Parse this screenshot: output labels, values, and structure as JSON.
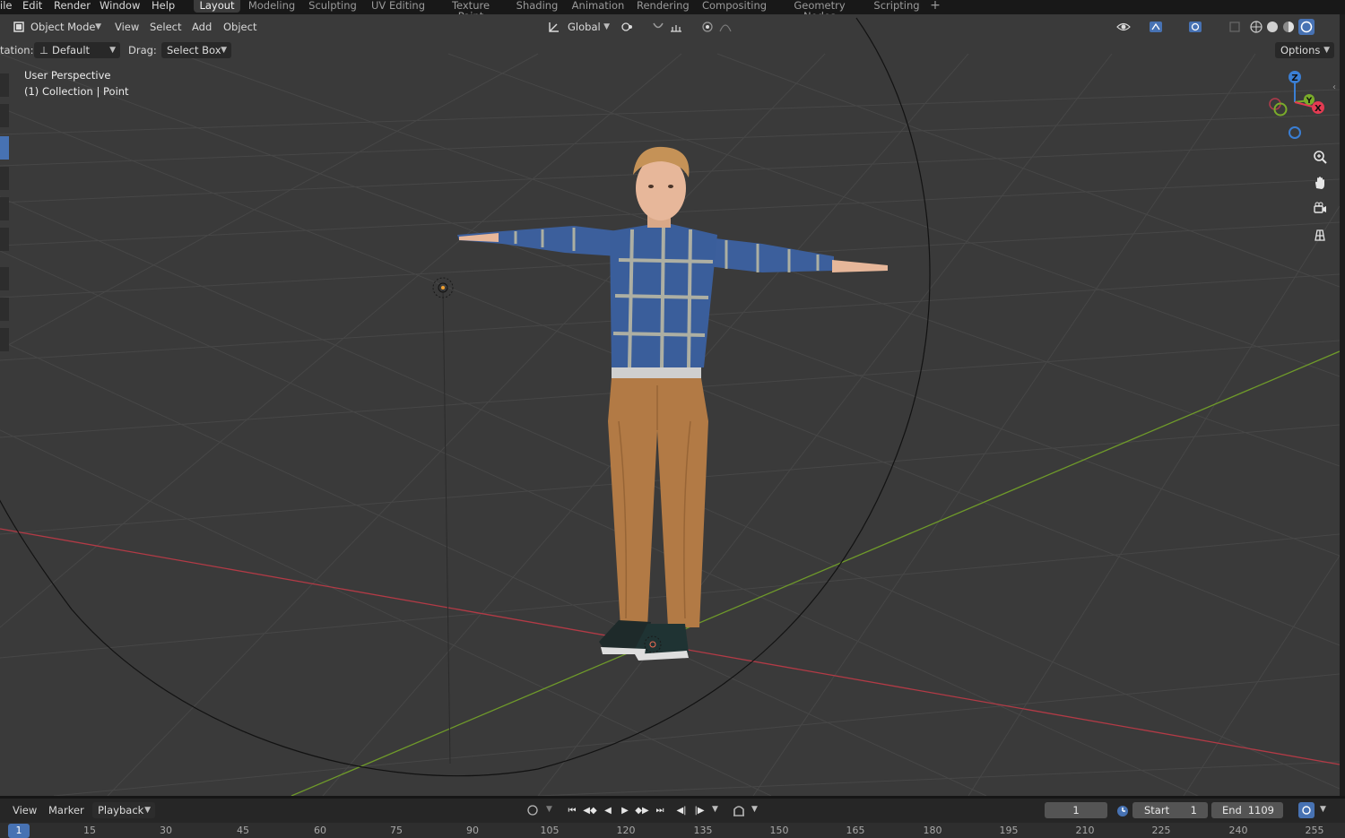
{
  "menu": {
    "items": [
      "ile",
      "Edit",
      "Render",
      "Window",
      "Help"
    ]
  },
  "workspaces": {
    "tabs": [
      "Layout",
      "Modeling",
      "Sculpting",
      "UV Editing",
      "Texture Paint",
      "Shading",
      "Animation",
      "Rendering",
      "Compositing",
      "Geometry Nodes",
      "Scripting"
    ],
    "active": "Layout",
    "add_label": "+"
  },
  "viewport_header": {
    "mode_label": "Object Mode",
    "menus": [
      "View",
      "Select",
      "Add",
      "Object"
    ],
    "transform_orientation": "Global"
  },
  "tool_settings": {
    "orientation_label": "tation:",
    "orientation_value": "Default",
    "drag_label": "Drag:",
    "drag_value": "Select Box",
    "options_label": "Options"
  },
  "viewport_overlay": {
    "view_name": "User Perspective",
    "collection_info": "(1) Collection | Point"
  },
  "gizmo": {
    "axis_labels": [
      "Z",
      "Y",
      "X"
    ],
    "colors": {
      "x": "#e33b52",
      "y": "#7aac2a",
      "z": "#3a7fd5"
    }
  },
  "timeline": {
    "menus": [
      "View",
      "Marker"
    ],
    "playback_label": "Playback",
    "current_frame": "1",
    "start_label": "Start",
    "start_value": "1",
    "end_label": "End",
    "end_value": "1109",
    "ruler_current": "1",
    "ruler_ticks": [
      "15",
      "30",
      "45",
      "60",
      "75",
      "90",
      "105",
      "120",
      "135",
      "150",
      "165",
      "180",
      "195",
      "210",
      "225",
      "240",
      "255"
    ]
  },
  "colors": {
    "accent": "#4772b3",
    "x_axis": "#b33a46",
    "y_axis": "#6f9a2a",
    "viewport_bg": "#3a3a3a"
  }
}
